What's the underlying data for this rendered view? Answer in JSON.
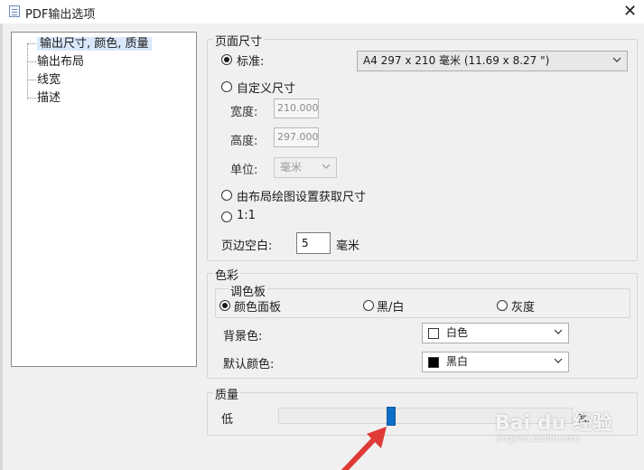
{
  "window": {
    "title": "PDF输出选项",
    "close_glyph": "✕"
  },
  "tree": {
    "items": [
      {
        "label": "输出尺寸, 颜色, 质量",
        "selected": true
      },
      {
        "label": "输出布局",
        "selected": false
      },
      {
        "label": "线宽",
        "selected": false
      },
      {
        "label": "描述",
        "selected": false
      }
    ]
  },
  "page_size": {
    "legend": "页面尺寸",
    "standard_label": "标准:",
    "standard_value": "A4 297 x 210 毫米 (11.69 x 8.27 \")",
    "custom_label": "自定义尺寸",
    "width_label": "宽度:",
    "width_value": "210.000",
    "height_label": "高度:",
    "height_value": "297.000",
    "unit_label": "单位:",
    "unit_value": "毫米",
    "layout_label": "由布局绘图设置获取尺寸",
    "one_to_one_label": "1:1",
    "margin_label": "页边空白:",
    "margin_value": "5",
    "margin_unit": "毫米"
  },
  "color": {
    "legend": "色彩",
    "palette_legend": "调色板",
    "color_palette_label": "颜色面板",
    "bw_label": "黑/白",
    "gray_label": "灰度",
    "background_label": "背景色:",
    "background_value": "白色",
    "background_swatch": "#ffffff",
    "default_label": "默认颜色:",
    "default_value": "黑白",
    "default_swatch": "#000000"
  },
  "quality": {
    "legend": "质量",
    "low_label": "低",
    "high_label": "高",
    "slider_value": 0.38
  },
  "overlay": {
    "arrow_color": "#e03a36",
    "watermark_text": "Bai du 经验",
    "watermark_sub": "jingyan.baidu.com"
  }
}
